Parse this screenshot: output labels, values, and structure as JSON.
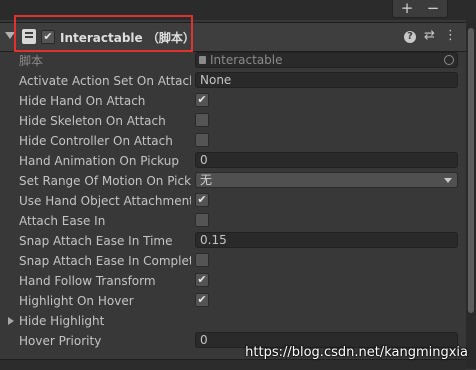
{
  "toolbar": {
    "add_label": "+",
    "remove_label": "−"
  },
  "component": {
    "title": "Interactable （脚本）",
    "enabled_mark": "✔",
    "icons": [
      "script-icon",
      "help-icon",
      "preset-icon",
      "more-icon"
    ],
    "help_glyph": "?",
    "preset_glyph": "⇄",
    "more_glyph": "⋮"
  },
  "properties": [
    {
      "label": "脚本",
      "type": "object",
      "value": "Interactable",
      "disabled": true
    },
    {
      "label": "Activate Action Set On Attach",
      "type": "object-plain",
      "value": "None"
    },
    {
      "label": "Hide Hand On Attach",
      "type": "check",
      "checked": true
    },
    {
      "label": "Hide Skeleton On Attach",
      "type": "check",
      "checked": false
    },
    {
      "label": "Hide Controller On Attach",
      "type": "check",
      "checked": false
    },
    {
      "label": "Hand Animation On Pickup",
      "type": "text",
      "value": "0"
    },
    {
      "label": "Set Range Of Motion On Pickup",
      "type": "dropdown",
      "value": "无"
    },
    {
      "label": "Use Hand Object Attachment Point",
      "type": "check",
      "checked": true
    },
    {
      "label": "Attach Ease In",
      "type": "check",
      "checked": false
    },
    {
      "label": "Snap Attach Ease In Time",
      "type": "text",
      "value": "0.15"
    },
    {
      "label": "Snap Attach Ease In Completed",
      "type": "check",
      "checked": false
    },
    {
      "label": "Hand Follow Transform",
      "type": "check",
      "checked": true
    },
    {
      "label": "Highlight On Hover",
      "type": "check",
      "checked": true
    },
    {
      "label": "Hide Highlight",
      "type": "foldout"
    },
    {
      "label": "Hover Priority",
      "type": "text",
      "value": "0"
    }
  ],
  "check_mark": "✔",
  "watermark": "https://blog.csdn.net/kangmingxia",
  "colors": {
    "highlight_box": "#e0312f",
    "background": "#383838",
    "field": "#2a2a2a"
  }
}
